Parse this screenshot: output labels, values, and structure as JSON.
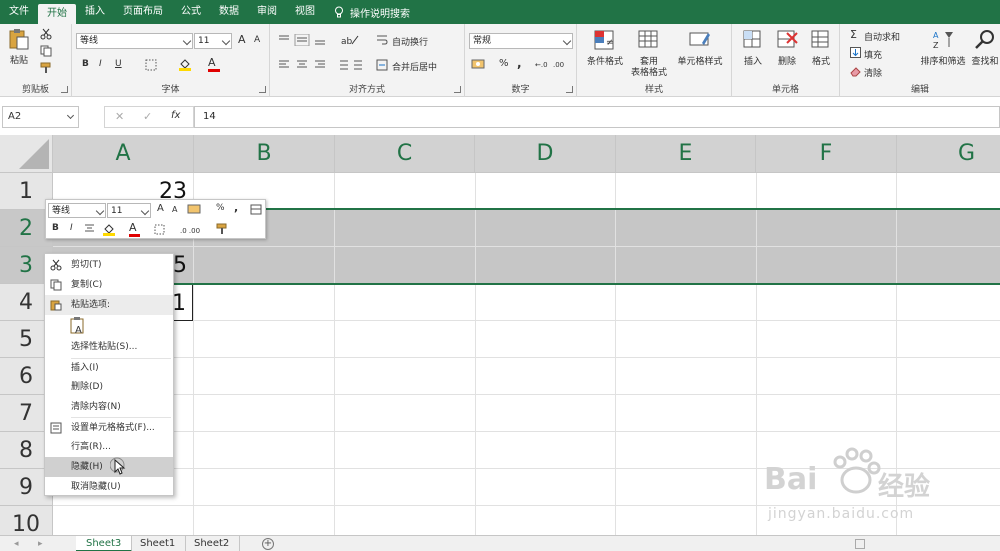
{
  "ribbon_tabs": [
    "文件",
    "开始",
    "插入",
    "页面布局",
    "公式",
    "数据",
    "审阅",
    "视图"
  ],
  "active_tab": "开始",
  "tell_me": "操作说明搜索",
  "clipboard": {
    "paste": "粘贴",
    "label": "剪贴板"
  },
  "font": {
    "name": "等线",
    "size": "11",
    "label": "字体",
    "bold": "B",
    "italic": "I",
    "underline": "U",
    "grow": "A",
    "shrink": "A",
    "color_letter": "A"
  },
  "alignment": {
    "wrap": "自动换行",
    "merge": "合并后居中",
    "label": "对齐方式"
  },
  "number": {
    "format": "常规",
    "label": "数字",
    "percent": "%",
    "comma": ","
  },
  "styles": {
    "conditional": "条件格式",
    "table_1": "套用",
    "table_2": "表格格式",
    "cell_styles": "单元格样式",
    "label": "样式"
  },
  "cells": {
    "insert": "插入",
    "delete": "删除",
    "format": "格式",
    "label": "单元格"
  },
  "editing": {
    "autosum": "自动求和",
    "fill": "填充",
    "clear": "清除",
    "sort": "排序和筛选",
    "find": "查找和",
    "label": "编辑"
  },
  "formula_bar": {
    "name_box": "A2",
    "cancel": "✕",
    "enter": "✓",
    "fx": "fx",
    "value": "14"
  },
  "columns": [
    "A",
    "B",
    "C",
    "D",
    "E",
    "F",
    "G"
  ],
  "rows": [
    "1",
    "2",
    "3",
    "4",
    "5",
    "6",
    "7",
    "8",
    "9",
    "10"
  ],
  "cell_values": {
    "A1": "23",
    "A3": "5",
    "A4": "1"
  },
  "mini_toolbar": {
    "font": "等线",
    "size": "11",
    "percent": "%",
    "comma": ",",
    "bold": "B",
    "italic": "I",
    "grow": "A",
    "shrink": "A",
    "color_letter": "A"
  },
  "context_menu": {
    "cut": "剪切(T)",
    "copy": "复制(C)",
    "paste_options": "粘贴选项:",
    "paste_special": "选择性粘贴(S)...",
    "insert": "插入(I)",
    "delete": "删除(D)",
    "clear": "清除内容(N)",
    "format_cells": "设置单元格格式(F)...",
    "row_height": "行高(R)...",
    "hide": "隐藏(H)",
    "unhide": "取消隐藏(U)"
  },
  "sheets": [
    "Sheet3",
    "Sheet1",
    "Sheet2"
  ],
  "active_sheet": "Sheet3",
  "watermark": {
    "brand": "Bai",
    "brand_cn": "经验",
    "url": "jingyan.baidu.com"
  },
  "colors": {
    "accent": "#217346",
    "selection": "#c6c6c6",
    "header": "#e6e6e6"
  }
}
